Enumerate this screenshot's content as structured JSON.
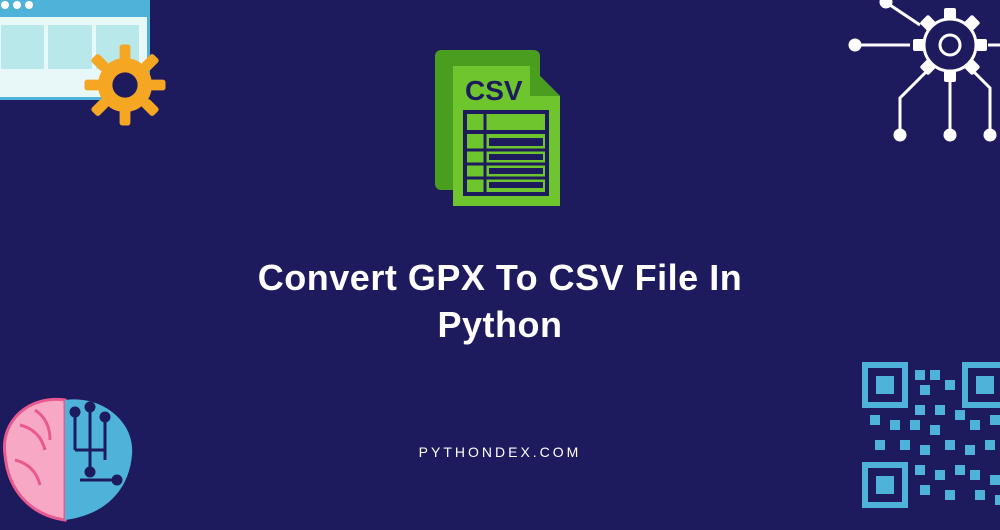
{
  "title": "Convert GPX To CSV File In Python",
  "footer": "PYTHONDEX.COM",
  "icon_label": "CSV",
  "decorations": {
    "top_left": "window-gear-decoration",
    "top_right": "circuit-gear-decoration",
    "bottom_left": "brain-decoration",
    "bottom_right": "qr-code-decoration"
  },
  "colors": {
    "background": "#1e1a5e",
    "accent_green": "#6ec52e",
    "accent_blue": "#4fb3d9",
    "accent_orange": "#f5a623",
    "text": "#ffffff"
  }
}
